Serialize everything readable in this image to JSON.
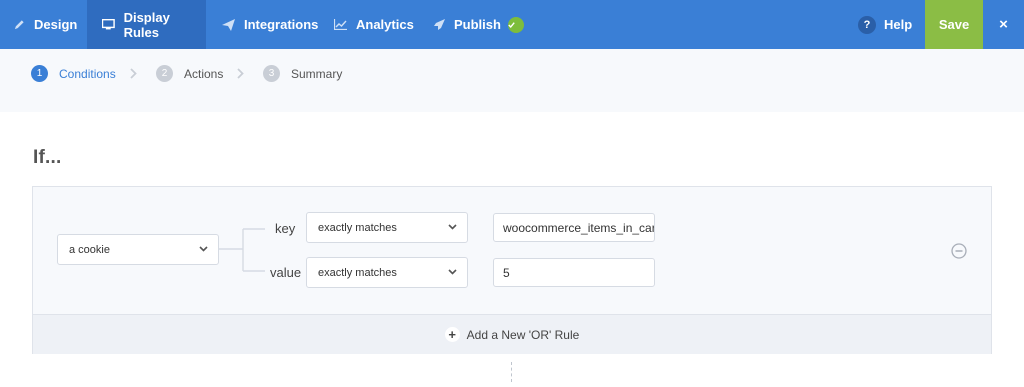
{
  "nav": {
    "items": [
      {
        "label": "Design",
        "icon": "pencil-icon"
      },
      {
        "label": "Display Rules",
        "icon": "monitor-icon"
      },
      {
        "label": "Integrations",
        "icon": "paper-plane-icon"
      },
      {
        "label": "Analytics",
        "icon": "chart-line-icon"
      },
      {
        "label": "Publish",
        "icon": "rocket-icon"
      }
    ],
    "help_label": "Help",
    "help_glyph": "?",
    "save_label": "Save",
    "close_glyph": "×"
  },
  "steps": [
    {
      "num": "1",
      "label": "Conditions"
    },
    {
      "num": "2",
      "label": "Actions"
    },
    {
      "num": "3",
      "label": "Summary"
    }
  ],
  "rule": {
    "heading": "If...",
    "condition_type": "a cookie",
    "key_label": "key",
    "key_operator": "exactly matches",
    "key_value": "woocommerce_items_in_car",
    "value_label": "value",
    "value_operator": "exactly matches",
    "value_value": "5",
    "add_or_label": "Add a New 'OR' Rule"
  },
  "colors": {
    "nav_bg": "#3a7fd6",
    "nav_active": "#2f6cbf",
    "save_bg": "#8bbd45",
    "accent": "#3a7fd6"
  }
}
